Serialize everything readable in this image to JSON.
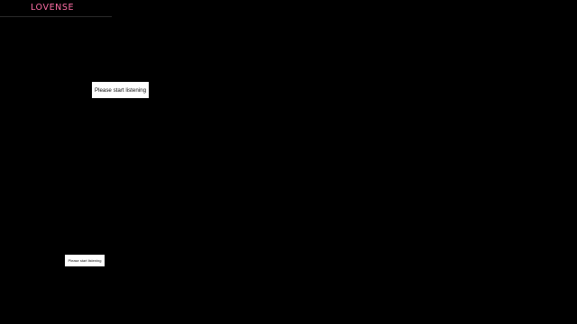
{
  "app": {
    "logo_text": "LOVENSE",
    "brand_color": "#ff6ea6",
    "background_color": "#000000"
  },
  "prompts": {
    "primary": "Please start listening",
    "secondary": "Please start listening"
  }
}
